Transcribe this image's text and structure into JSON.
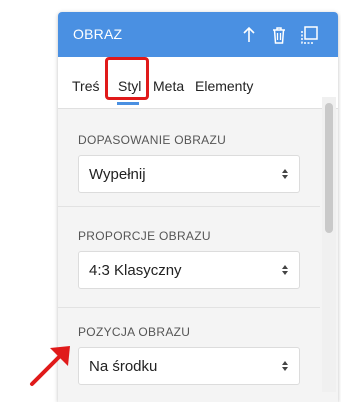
{
  "panel": {
    "title": "OBRAZ",
    "header_icons": [
      "arrow-up-icon",
      "trash-icon",
      "duplicate-icon"
    ],
    "accent_color": "#4a90e2"
  },
  "tabs": [
    {
      "label": "Treść",
      "display": "Treś"
    },
    {
      "label": "Styl",
      "active": true
    },
    {
      "label": "Meta"
    },
    {
      "label": "Elementy"
    }
  ],
  "sections": [
    {
      "label": "DOPASOWANIE OBRAZU",
      "value": "Wypełnij"
    },
    {
      "label": "PROPORCJE OBRAZU",
      "value": "4:3 Klasyczny"
    },
    {
      "label": "POZYCJA OBRAZU",
      "value": "Na środku"
    }
  ],
  "annotations": {
    "highlight_color": "#e01a1a"
  }
}
